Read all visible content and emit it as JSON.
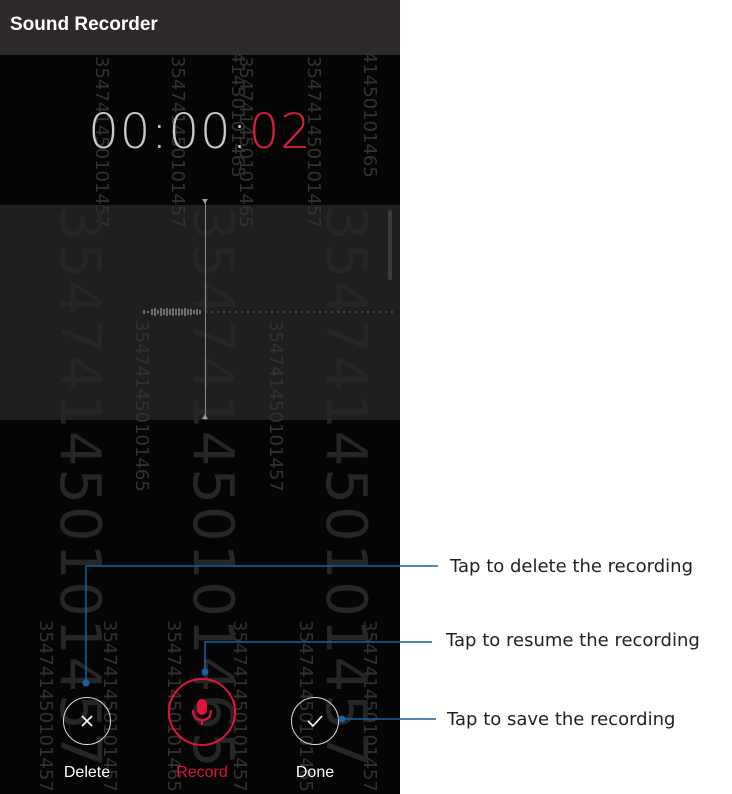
{
  "app": {
    "title": "Sound Recorder"
  },
  "timer": {
    "main": "00:00:",
    "seconds": "02"
  },
  "watermark": {
    "serial_a": "354741450101457",
    "serial_b": "354741450101465"
  },
  "controls": {
    "delete_label": "Delete",
    "record_label": "Record",
    "done_label": "Done"
  },
  "callouts": {
    "delete": "Tap to delete the recording",
    "resume": "Tap to resume the recording",
    "save": "Tap to save the recording"
  },
  "colors": {
    "accent": "#e0143c",
    "timer_seconds": "#d21f3c",
    "callout_line": "#1f5fa0"
  },
  "icons": {
    "delete": "close-icon",
    "record": "microphone-icon",
    "done": "check-icon"
  }
}
